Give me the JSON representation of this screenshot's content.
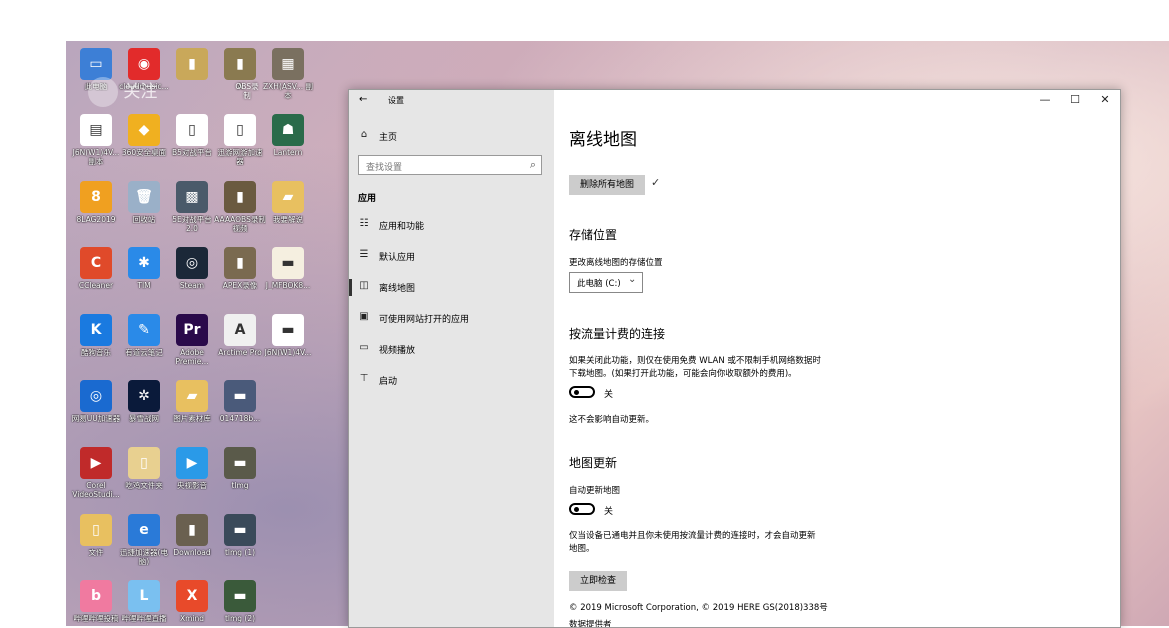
{
  "desktop": {
    "watermark": "关注",
    "icons": [
      {
        "label": "此电脑",
        "color": "#3d7fd6",
        "glyph": "▭",
        "col": 0,
        "row": 0
      },
      {
        "label": "cloudmusic...",
        "color": "#e22b2b",
        "glyph": "◉",
        "col": 1,
        "row": 0
      },
      {
        "label": "",
        "color": "#c9a85a",
        "glyph": "▮",
        "col": 2,
        "row": 0
      },
      {
        "label": "A",
        "color": "#8a7a50",
        "glyph": "▮",
        "col": 3,
        "row": 0
      },
      {
        "label": "OBS录制",
        "color": "#6b6040",
        "glyph": "▮",
        "col": 3,
        "row": 0,
        "sub": true
      },
      {
        "label": "ZXH(ASV... 副本",
        "color": "#7a7060",
        "glyph": "▦",
        "col": 4,
        "row": 0
      },
      {
        "label": "J6N(W1)4V... 副本",
        "color": "#ffffff",
        "glyph": "▤",
        "col": 0,
        "row": 1
      },
      {
        "label": "360安全桌面",
        "color": "#f0b020",
        "glyph": "◆",
        "col": 1,
        "row": 1
      },
      {
        "label": "B5对战平台",
        "color": "#ffffff",
        "glyph": "▯",
        "col": 2,
        "row": 1
      },
      {
        "label": "迅游网游加速器",
        "color": "#ffffff",
        "glyph": "▯",
        "col": 3,
        "row": 1
      },
      {
        "label": "Lantern",
        "color": "#2a6b4a",
        "glyph": "☗",
        "col": 4,
        "row": 1
      },
      {
        "label": "8LAG2019",
        "color": "#f0a020",
        "glyph": "8",
        "col": 0,
        "row": 2
      },
      {
        "label": "回收站",
        "color": "#9ab0c8",
        "glyph": "🗑",
        "col": 1,
        "row": 2
      },
      {
        "label": "5E对战平台 2.0",
        "color": "#4a5a6a",
        "glyph": "▩",
        "col": 2,
        "row": 2
      },
      {
        "label": "AAAAOBS录制视频",
        "color": "#6a5a40",
        "glyph": "▮",
        "col": 3,
        "row": 2
      },
      {
        "label": "我要解说",
        "color": "#e8c060",
        "glyph": "▰",
        "col": 4,
        "row": 2
      },
      {
        "label": "CCleaner",
        "color": "#e04a2a",
        "glyph": "C",
        "col": 0,
        "row": 3
      },
      {
        "label": "TIM",
        "color": "#2a8ae8",
        "glyph": "✱",
        "col": 1,
        "row": 3
      },
      {
        "label": "Steam",
        "color": "#1b2838",
        "glyph": "◎",
        "col": 2,
        "row": 3
      },
      {
        "label": "APEX录像",
        "color": "#7a6a50",
        "glyph": "▮",
        "col": 3,
        "row": 3
      },
      {
        "label": "J_MFBOK8...",
        "color": "#f5efe0",
        "glyph": "▬",
        "col": 4,
        "row": 3
      },
      {
        "label": "酷狗音乐",
        "color": "#1a7ae0",
        "glyph": "K",
        "col": 0,
        "row": 4
      },
      {
        "label": "有道云笔记",
        "color": "#2a8ae8",
        "glyph": "✎",
        "col": 1,
        "row": 4
      },
      {
        "label": "Adobe Premie...",
        "color": "#2a0a4a",
        "glyph": "Pr",
        "col": 2,
        "row": 4
      },
      {
        "label": "Arctime Pro",
        "color": "#f0f0f0",
        "glyph": "A",
        "col": 3,
        "row": 4
      },
      {
        "label": "J6N(W1)4V...",
        "color": "#ffffff",
        "glyph": "▬",
        "col": 4,
        "row": 4
      },
      {
        "label": "网易UU加速器",
        "color": "#1a6ad0",
        "glyph": "◎",
        "col": 0,
        "row": 5
      },
      {
        "label": "暴雪战网",
        "color": "#0a1a3a",
        "glyph": "✲",
        "col": 1,
        "row": 5
      },
      {
        "label": "图片素材库",
        "color": "#e8c060",
        "glyph": "▰",
        "col": 2,
        "row": 5
      },
      {
        "label": "014718b...",
        "color": "#4a5a7a",
        "glyph": "▬",
        "col": 3,
        "row": 5
      },
      {
        "label": "Corel VideoStudi...",
        "color": "#c02a2a",
        "glyph": "▶",
        "col": 0,
        "row": 6
      },
      {
        "label": "吃鸡文件夹",
        "color": "#e8d090",
        "glyph": "▯",
        "col": 1,
        "row": 6
      },
      {
        "label": "央视影音",
        "color": "#2a9ae8",
        "glyph": "▶",
        "col": 2,
        "row": 6
      },
      {
        "label": "tlmg",
        "color": "#5a5a4a",
        "glyph": "▬",
        "col": 3,
        "row": 6
      },
      {
        "label": "文件",
        "color": "#e8c060",
        "glyph": "▯",
        "col": 0,
        "row": 7
      },
      {
        "label": "迅捷加速器(电脑)",
        "color": "#2a7ad8",
        "glyph": "e",
        "col": 1,
        "row": 7
      },
      {
        "label": "Download",
        "color": "#6a6050",
        "glyph": "▮",
        "col": 2,
        "row": 7
      },
      {
        "label": "tlmg (1)",
        "color": "#3a4a5a",
        "glyph": "▬",
        "col": 3,
        "row": 7
      },
      {
        "label": "哔哩哔哩投稿",
        "color": "#f07aa0",
        "glyph": "b",
        "col": 0,
        "row": 8
      },
      {
        "label": "哔哩哔哩直播",
        "color": "#7ac0f0",
        "glyph": "L",
        "col": 1,
        "row": 8
      },
      {
        "label": "Xmind",
        "color": "#e84a2a",
        "glyph": "X",
        "col": 2,
        "row": 8
      },
      {
        "label": "tlmg (2)",
        "color": "#3a5a3a",
        "glyph": "▬",
        "col": 3,
        "row": 8
      }
    ]
  },
  "window": {
    "title": "设置",
    "back_glyph": "←",
    "controls": {
      "minimize": "—",
      "maximize": "☐",
      "close": "✕"
    },
    "sidebar": {
      "home_label": "主页",
      "home_glyph": "⌂",
      "search_placeholder": "查找设置",
      "search_glyph": "⌕",
      "section": "应用",
      "items": [
        {
          "label": "应用和功能",
          "glyph": "☷"
        },
        {
          "label": "默认应用",
          "glyph": "☰"
        },
        {
          "label": "离线地图",
          "glyph": "◫",
          "selected": true
        },
        {
          "label": "可使用网站打开的应用",
          "glyph": "▣"
        },
        {
          "label": "视频播放",
          "glyph": "▭"
        },
        {
          "label": "启动",
          "glyph": "⊤"
        }
      ]
    },
    "main": {
      "title": "离线地图",
      "delete_button": "删除所有地图",
      "check_glyph": "✓",
      "storage_heading": "存储位置",
      "storage_label": "更改离线地图的存储位置",
      "storage_value": "此电脑 (C:)",
      "storage_chevron": "⌄",
      "metered_heading": "按流量计费的连接",
      "metered_desc_1": "如果关闭此功能，则仅在使用免费 WLAN 或不限制手机网络数据时",
      "metered_desc_2": "下载地图。(如果打开此功能，可能会向你收取额外的费用)。",
      "metered_toggle": "关",
      "metered_note": "这不会影响自动更新。",
      "update_heading": "地图更新",
      "update_label": "自动更新地图",
      "update_toggle": "关",
      "update_desc_1": "仅当设备已通电并且你未使用按流量计费的连接时，才会自动更新",
      "update_desc_2": "地图。",
      "check_button": "立即检查",
      "copyright": "© 2019 Microsoft Corporation, © 2019 HERE GS(2018)338号",
      "data_provider": "数据提供者"
    }
  }
}
